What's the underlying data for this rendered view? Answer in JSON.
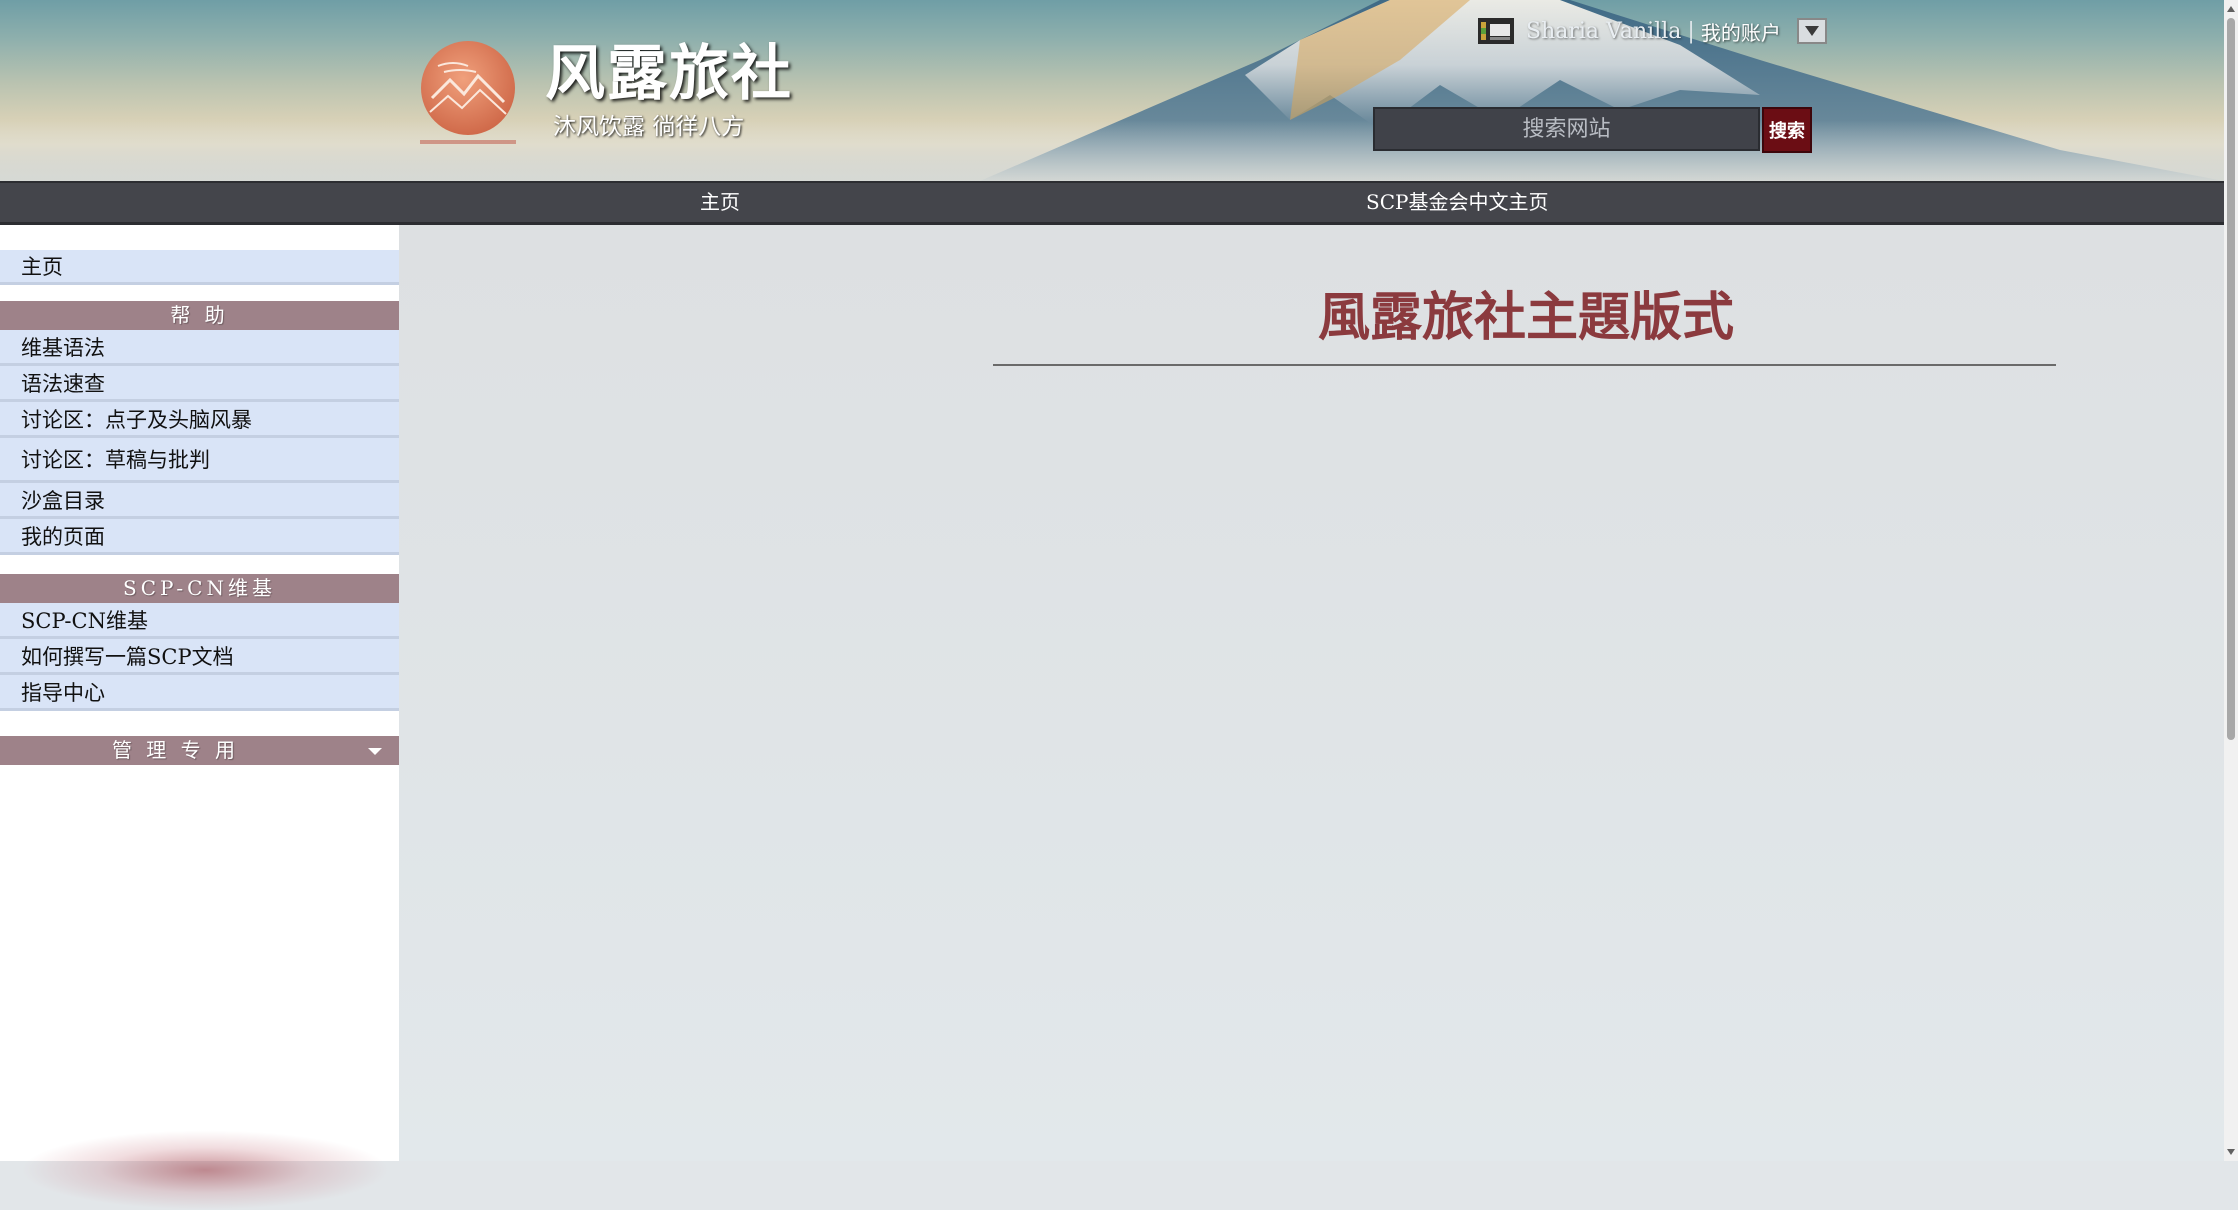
{
  "header": {
    "site_title": "风露旅社",
    "site_subtitle": "沐风饮露 徜徉八方",
    "account": {
      "username": "Sharia Vanilla",
      "separator": "|",
      "account_link": "我的账户"
    },
    "search": {
      "placeholder": "搜索网站",
      "button_label": "搜索"
    }
  },
  "top_nav": {
    "items": [
      {
        "label": "主页"
      },
      {
        "label": "SCP基金会中文主页"
      }
    ]
  },
  "sidebar": {
    "home": "主页",
    "help_heading": "帮 助",
    "help_items": [
      "维基语法",
      "语法速查",
      "讨论区：点子及头脑风暴",
      "讨论区：草稿与批判",
      "沙盒目录",
      "我的页面"
    ],
    "wiki_heading": "SCP-CN维基",
    "wiki_items": [
      "SCP-CN维基",
      "如何撰写一篇SCP文档",
      "指导中心"
    ],
    "admin_heading": "管 理 专 用"
  },
  "main": {
    "page_title": "風露旅社主題版式"
  },
  "colors": {
    "nav_bg": "#44454b",
    "sidebar_item_bg": "#d9e4f7",
    "sidebar_heading_bg": "#9e8289",
    "title_color": "#8b3a3e",
    "search_button_bg": "#6b0d14"
  }
}
